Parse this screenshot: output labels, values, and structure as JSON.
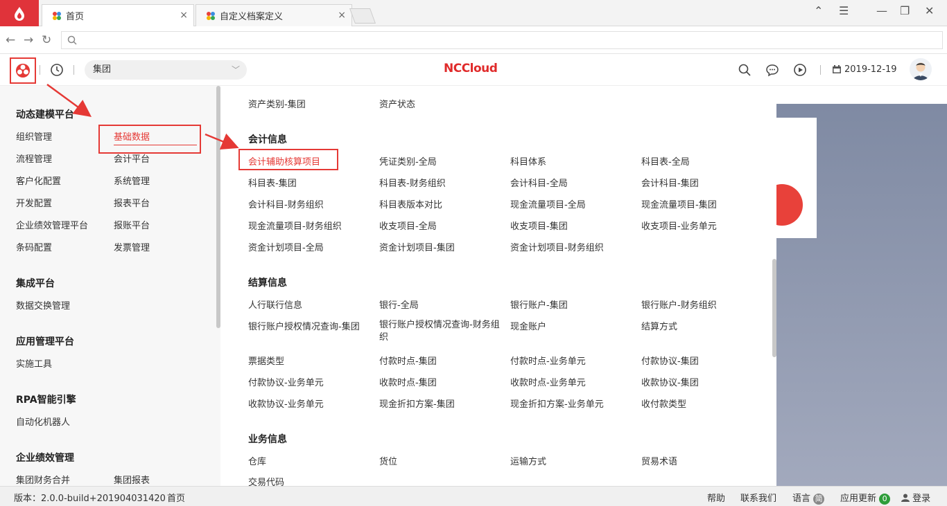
{
  "browser": {
    "tabs": [
      {
        "label": "首页",
        "close": "×"
      },
      {
        "label": "自定义档案定义",
        "close": "×"
      }
    ],
    "window_buttons": [
      "⌃",
      "☰",
      "—",
      "❐",
      "✕"
    ]
  },
  "header": {
    "group_select": {
      "value": "集团"
    },
    "brand": "NCCloud",
    "date": "2019-12-19"
  },
  "left_nav": {
    "sections": [
      {
        "title": "动态建模平台",
        "items": [
          [
            "组织管理",
            "基础数据"
          ],
          [
            "流程管理",
            "会计平台"
          ],
          [
            "客户化配置",
            "系统管理"
          ],
          [
            "开发配置",
            "报表平台"
          ],
          [
            "企业绩效管理平台",
            "报账平台"
          ],
          [
            "条码配置",
            "发票管理"
          ]
        ]
      },
      {
        "title": "集成平台",
        "items": [
          [
            "数据交换管理",
            ""
          ]
        ]
      },
      {
        "title": "应用管理平台",
        "items": [
          [
            "实施工具",
            ""
          ]
        ]
      },
      {
        "title": "RPA智能引擎",
        "items": [
          [
            "自动化机器人",
            ""
          ]
        ]
      },
      {
        "title": "企业绩效管理",
        "items": [
          [
            "集团财务合并",
            "集团报表"
          ]
        ]
      }
    ]
  },
  "main_menu": {
    "top_row": [
      "资产类别-集团",
      "资产状态"
    ],
    "sections": [
      {
        "title": "会计信息",
        "rows": [
          [
            "会计辅助核算项目",
            "凭证类别-全局",
            "科目体系",
            "科目表-全局"
          ],
          [
            "科目表-集团",
            "科目表-财务组织",
            "会计科目-全局",
            "会计科目-集团"
          ],
          [
            "会计科目-财务组织",
            "科目表版本对比",
            "现金流量项目-全局",
            "现金流量项目-集团"
          ],
          [
            "现金流量项目-财务组织",
            "收支项目-全局",
            "收支项目-集团",
            "收支项目-业务单元"
          ],
          [
            "资金计划项目-全局",
            "资金计划项目-集团",
            "资金计划项目-财务组织",
            ""
          ]
        ]
      },
      {
        "title": "结算信息",
        "rows": [
          [
            "人行联行信息",
            "银行-全局",
            "银行账户-集团",
            "银行账户-财务组织"
          ],
          [
            "银行账户授权情况查询-集团",
            "银行账户授权情况查询-财务组织",
            "现金账户",
            "结算方式"
          ],
          [
            "票据类型",
            "付款时点-集团",
            "付款时点-业务单元",
            "付款协议-集团"
          ],
          [
            "付款协议-业务单元",
            "收款时点-集团",
            "收款时点-业务单元",
            "收款协议-集团"
          ],
          [
            "收款协议-业务单元",
            "现金折扣方案-集团",
            "现金折扣方案-业务单元",
            "收付款类型"
          ]
        ]
      },
      {
        "title": "业务信息",
        "rows": [
          [
            "仓库",
            "货位",
            "运输方式",
            "贸易术语"
          ],
          [
            "交易代码",
            "",
            "",
            ""
          ]
        ]
      }
    ]
  },
  "footer": {
    "version": "版本：2.0.0-build+201904031420",
    "home": "首页",
    "help": "帮助",
    "contact": "联系我们",
    "language": "语言",
    "language_badge": "简",
    "update": "应用更新",
    "update_count": "0",
    "login": "登录"
  },
  "colors": {
    "accent": "#e53935",
    "brand": "#e02b2b",
    "update_badge": "#2e9d3a",
    "lang_badge": "#888888"
  }
}
